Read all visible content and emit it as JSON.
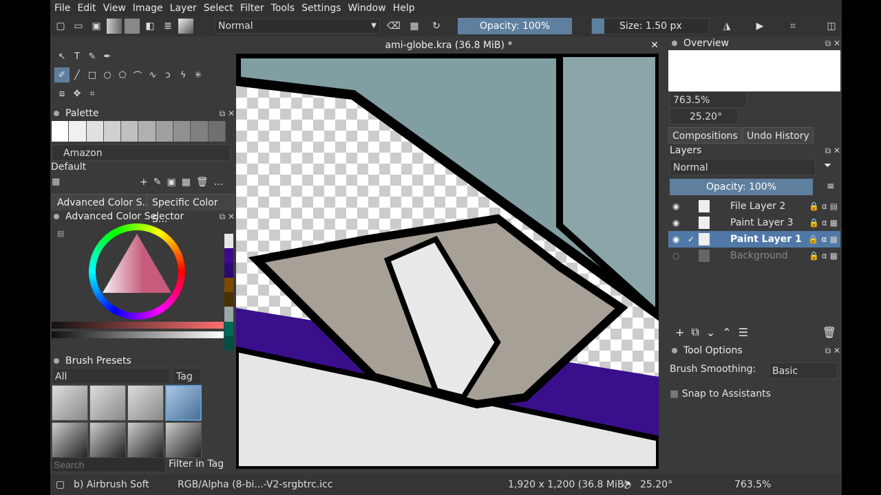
{
  "menu": [
    "File",
    "Edit",
    "View",
    "Image",
    "Layer",
    "Select",
    "Filter",
    "Tools",
    "Settings",
    "Window",
    "Help"
  ],
  "toolbar": {
    "blend_mode": "Normal",
    "opacity": "Opacity: 100%",
    "size": "Size: 1.50 px"
  },
  "palette_panel": {
    "title": "Palette",
    "palette_name": "Amazon",
    "set_name": "Default",
    "swatches": [
      "#ffffff",
      "#f0f0f0",
      "#e0e0e0",
      "#d0d0d0",
      "#c0c0c0",
      "#b0b0b0",
      "#a0a0a0",
      "#909090",
      "#808080",
      "#707070"
    ]
  },
  "color_tabs": [
    "Advanced Color S...",
    "Specific Color S..."
  ],
  "color_selector": {
    "title": "Advanced Color Selector",
    "side_colors": [
      "#e6e6e6",
      "#3d0a88",
      "#2a0a70",
      "#7a4b00",
      "#4a3000",
      "#9aa8a8",
      "#00695a",
      "#004f44"
    ]
  },
  "brush_presets": {
    "title": "Brush Presets",
    "filter": "All",
    "tag": "Tag",
    "search_placeholder": "Search",
    "filter_in_tag": "Filter in Tag"
  },
  "document": {
    "tab_title": "ami-globe.kra (36.8 MiB) *"
  },
  "overview": {
    "title": "Overview",
    "zoom": "763.5%",
    "rotation": "25.20°"
  },
  "right_tabs": [
    "Compositions",
    "Undo History"
  ],
  "layers": {
    "title": "Layers",
    "blend_mode": "Normal",
    "opacity": "Opacity:  100%",
    "items": [
      {
        "name": "File Layer 2"
      },
      {
        "name": "Paint Layer 3"
      },
      {
        "name": "Paint Layer 1"
      },
      {
        "name": "Background"
      }
    ]
  },
  "tool_options": {
    "title": "Tool Options",
    "smoothing_label": "Brush Smoothing:",
    "smoothing_value": "Basic",
    "snap_label": "Snap to Assistants"
  },
  "status": {
    "brush": "b) Airbrush Soft",
    "color_profile": "RGB/Alpha (8-bi...-V2-srgbtrc.icc",
    "dimensions": "1,920 x 1,200 (36.8 MiB)",
    "rotation": "25.20°",
    "zoom": "763.5%"
  }
}
